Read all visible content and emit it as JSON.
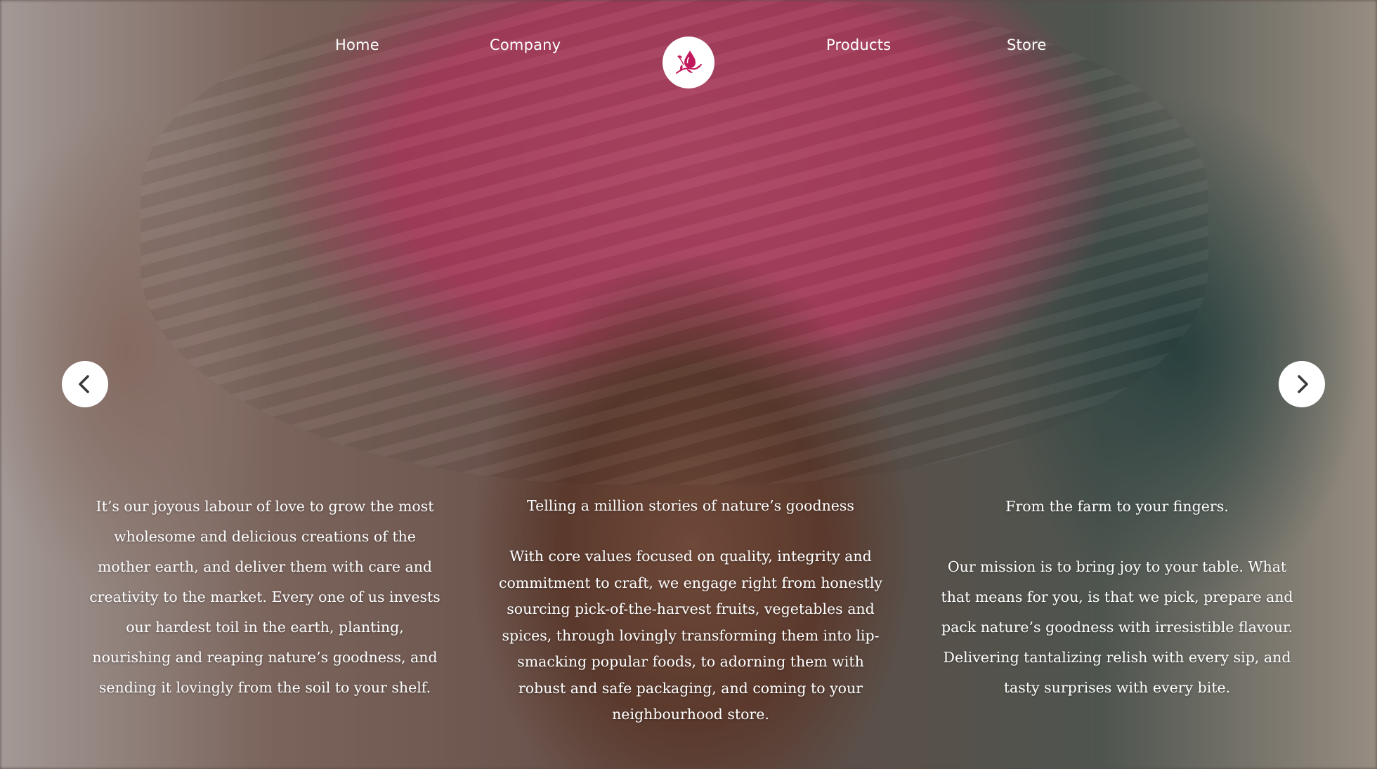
{
  "nav": {
    "items": [
      {
        "label": "Home"
      },
      {
        "label": "Company"
      },
      {
        "label": "Products"
      },
      {
        "label": "Store"
      }
    ],
    "logo_icon": "drop-and-leaf-logo-icon"
  },
  "carousel": {
    "prev_icon": "chevron-left-icon",
    "next_icon": "chevron-right-icon"
  },
  "columns": {
    "left": {
      "body": "It’s our joyous labour of love to grow the most wholesome and delicious creations of the mother earth, and deliver them with  care and creativity to the market. Every one of us invests our hardest toil in the earth, planting, nourishing and reaping nature’s goodness, and sending it lovingly from the soil to your shelf."
    },
    "middle": {
      "heading": "Telling a million stories of nature’s goodness",
      "body": "With core values focused on quality, integrity and commitment to craft, we engage right from honestly sourcing pick-of-the-harvest fruits, vegetables and spices, through lovingly transforming them into lip-smacking popular foods, to adorning them with robust and safe packaging, and coming to your neighbourhood store."
    },
    "right": {
      "heading": "From the farm to your fingers.",
      "body": "Our mission is to bring joy to your table. What that means for you, is that we pick, prepare and pack nature’s goodness with irresistible flavour. Delivering tantalizing relish with every sip, and tasty surprises with every bite."
    }
  },
  "colors": {
    "accent": "#c2185b",
    "text": "#ffffff"
  }
}
